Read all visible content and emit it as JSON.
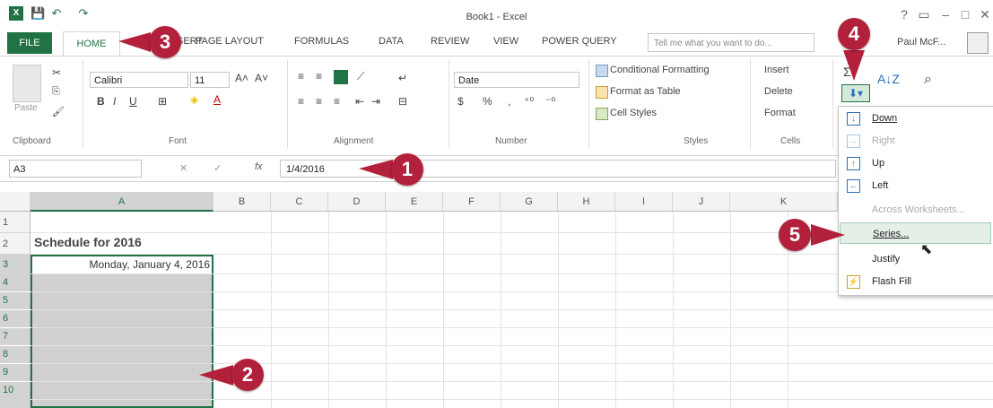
{
  "app": {
    "title": "Book1 - Excel",
    "logo_letter": "X",
    "user": "Paul McF...",
    "window_controls": [
      "?",
      "▭",
      "–",
      "□",
      "✕"
    ]
  },
  "qat": {
    "save_icon": "save-icon",
    "undo_icon": "undo-icon",
    "redo_icon": "redo-icon"
  },
  "tabs": [
    "FILE",
    "HOME",
    "INSERT",
    "PAGE LAYOUT",
    "FORMULAS",
    "DATA",
    "REVIEW",
    "VIEW",
    "POWER QUERY"
  ],
  "tell_me": {
    "placeholder": "Tell me what you want to do..."
  },
  "ribbon": {
    "clipboard": {
      "label": "Clipboard",
      "paste": "Paste"
    },
    "font": {
      "label": "Font",
      "name": "Calibri",
      "size": "11",
      "bold": "B",
      "italic": "I",
      "underline": "U"
    },
    "alignment": {
      "label": "Alignment"
    },
    "number": {
      "label": "Number",
      "format": "Date",
      "currency": "$",
      "percent": "%",
      "comma": ","
    },
    "styles": {
      "label": "Styles",
      "conditional": "Conditional Formatting",
      "format_table": "Format as Table",
      "cell_styles": "Cell Styles"
    },
    "cells": {
      "label": "Cells",
      "insert": "Insert",
      "delete": "Delete",
      "format": "Format"
    },
    "editing": {
      "sort": "Sort & Filter",
      "find": "Find & Select"
    }
  },
  "formula_bar": {
    "name_box": "A3",
    "fx": "fx",
    "value": "1/4/2016"
  },
  "columns": [
    "A",
    "B",
    "C",
    "D",
    "E",
    "F",
    "G",
    "H",
    "I",
    "J",
    "K"
  ],
  "rows": [
    {
      "num": "1",
      "a": ""
    },
    {
      "num": "2",
      "a": "Schedule for 2016"
    },
    {
      "num": "3",
      "a": "Monday, January 4, 2016"
    },
    {
      "num": "4",
      "a": ""
    },
    {
      "num": "5",
      "a": ""
    },
    {
      "num": "6",
      "a": ""
    },
    {
      "num": "7",
      "a": ""
    },
    {
      "num": "8",
      "a": ""
    },
    {
      "num": "9",
      "a": ""
    },
    {
      "num": "10",
      "a": ""
    }
  ],
  "fill_menu": {
    "items": [
      {
        "label": "Down",
        "enabled": true,
        "icon": "fill-down-icon"
      },
      {
        "label": "Right",
        "enabled": false,
        "icon": "fill-right-icon"
      },
      {
        "label": "Up",
        "enabled": true,
        "icon": "fill-up-icon"
      },
      {
        "label": "Left",
        "enabled": true,
        "icon": "fill-left-icon"
      },
      {
        "label": "Across Worksheets...",
        "enabled": false,
        "icon": ""
      },
      {
        "label": "Series...",
        "enabled": true,
        "icon": "",
        "highlighted": true
      },
      {
        "label": "Justify",
        "enabled": true,
        "icon": ""
      },
      {
        "label": "Flash Fill",
        "enabled": true,
        "icon": "flash-fill-icon"
      }
    ]
  },
  "callouts": [
    "1",
    "2",
    "3",
    "4",
    "5"
  ],
  "colors": {
    "excel_green": "#217346",
    "callout_red": "#b3203c",
    "selection_gray": "#d0d0d0",
    "menu_highlight": "#e3efe7"
  }
}
